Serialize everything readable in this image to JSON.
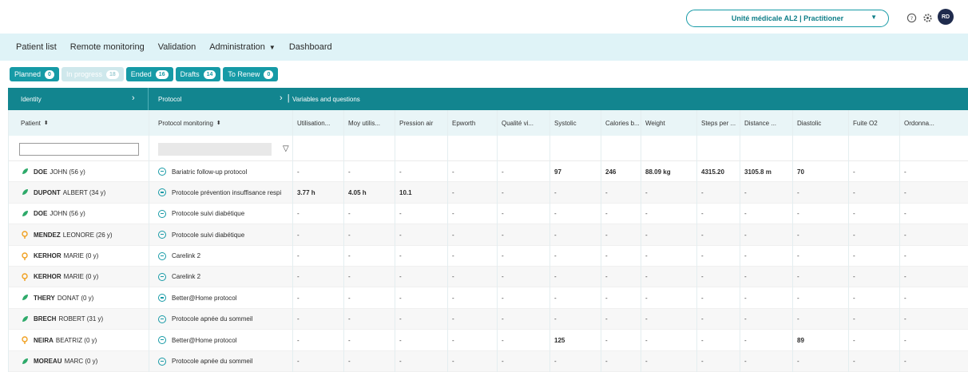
{
  "header": {
    "center_select": "Unité médicale AL2 | Practitioner",
    "avatar_initials": "RD"
  },
  "nav": {
    "items": [
      "Patient list",
      "Remote monitoring",
      "Validation",
      "Administration",
      "Dashboard"
    ]
  },
  "tabs": [
    {
      "label": "Planned",
      "count": "0",
      "active": true
    },
    {
      "label": "In progress",
      "count": "18",
      "active": false
    },
    {
      "label": "Ended",
      "count": "16",
      "active": true
    },
    {
      "label": "Drafts",
      "count": "14",
      "active": true
    },
    {
      "label": "To Renew",
      "count": "0",
      "active": true
    }
  ],
  "groups": {
    "identity": "Identity",
    "protocol": "Protocol",
    "variables": "Variables and questions"
  },
  "columns": {
    "patient": "Patient",
    "protocol": "Protocol monitoring",
    "vars": [
      "Utilisation...",
      "Moy utilis...",
      "Pression air",
      "Epworth",
      "Qualité vi...",
      "Systolic",
      "Calories b...",
      "Weight",
      "Steps per ...",
      "Distance ...",
      "Diastolic",
      "Fuite O2",
      "Ordonna..."
    ]
  },
  "rows": [
    {
      "last": "DOE",
      "first": "JOHN (56 y)",
      "icon": "leaf",
      "protocol": "Bariatric follow-up protocol",
      "vals": [
        "-",
        "-",
        "-",
        "-",
        "-",
        "97",
        "246",
        "88.09 kg",
        "4315.20",
        "3105.8 m",
        "70",
        "-",
        "-"
      ]
    },
    {
      "last": "DUPONT",
      "first": "ALBERT (34 y)",
      "icon": "leaf",
      "protocol": "Protocole prévention insuffisance respi",
      "vals": [
        "3.77 h",
        "4.05 h",
        "10.1",
        "-",
        "-",
        "-",
        "-",
        "-",
        "-",
        "-",
        "-",
        "-",
        "-"
      ]
    },
    {
      "last": "DOE",
      "first": "JOHN (56 y)",
      "icon": "leaf",
      "protocol": "Protocole suivi diabétique",
      "vals": [
        "-",
        "-",
        "-",
        "-",
        "-",
        "-",
        "-",
        "-",
        "-",
        "-",
        "-",
        "-",
        "-"
      ]
    },
    {
      "last": "MENDEZ",
      "first": "LEONORE (26 y)",
      "icon": "pin",
      "protocol": "Protocole suivi diabétique",
      "vals": [
        "-",
        "-",
        "-",
        "-",
        "-",
        "-",
        "-",
        "-",
        "-",
        "-",
        "-",
        "-",
        "-"
      ]
    },
    {
      "last": "KERHOR",
      "first": "MARIE (0 y)",
      "icon": "pin",
      "protocol": "Carelink 2",
      "vals": [
        "-",
        "-",
        "-",
        "-",
        "-",
        "-",
        "-",
        "-",
        "-",
        "-",
        "-",
        "-",
        "-"
      ]
    },
    {
      "last": "KERHOR",
      "first": "MARIE (0 y)",
      "icon": "pin",
      "protocol": "Carelink 2",
      "vals": [
        "-",
        "-",
        "-",
        "-",
        "-",
        "-",
        "-",
        "-",
        "-",
        "-",
        "-",
        "-",
        "-"
      ]
    },
    {
      "last": "THERY",
      "first": "DONAT (0 y)",
      "icon": "leaf",
      "protocol": "Better@Home protocol",
      "vals": [
        "-",
        "-",
        "-",
        "-",
        "-",
        "-",
        "-",
        "-",
        "-",
        "-",
        "-",
        "-",
        "-"
      ]
    },
    {
      "last": "BRECH",
      "first": "ROBERT (31 y)",
      "icon": "leaf",
      "protocol": "Protocole apnée du sommeil",
      "vals": [
        "-",
        "-",
        "-",
        "-",
        "-",
        "-",
        "-",
        "-",
        "-",
        "-",
        "-",
        "-",
        "-"
      ]
    },
    {
      "last": "NEIRA",
      "first": "BEATRIZ (0 y)",
      "icon": "pin",
      "protocol": "Better@Home protocol",
      "vals": [
        "-",
        "-",
        "-",
        "-",
        "-",
        "125",
        "-",
        "-",
        "-",
        "-",
        "89",
        "-",
        "-"
      ]
    },
    {
      "last": "MOREAU",
      "first": "MARC (0 y)",
      "icon": "leaf",
      "protocol": "Protocole apnée du sommeil",
      "vals": [
        "-",
        "-",
        "-",
        "-",
        "-",
        "-",
        "-",
        "-",
        "-",
        "-",
        "-",
        "-",
        "-"
      ]
    }
  ],
  "colors": {
    "teal": "#169aa6",
    "teal_dark": "#12858f",
    "leaf": "#2eaa6a",
    "pin": "#f0a020"
  }
}
